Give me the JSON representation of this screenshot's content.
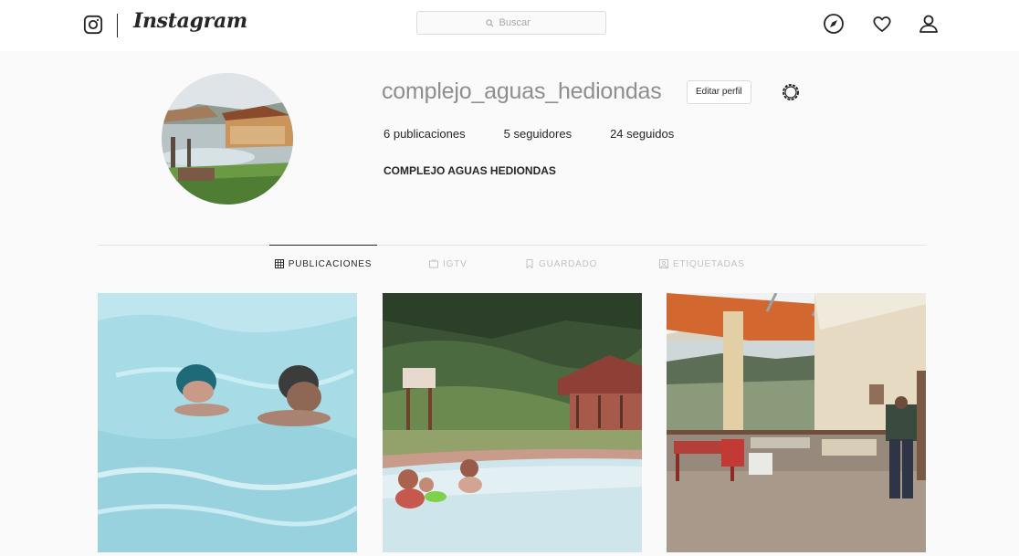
{
  "header": {
    "brand": "Instagram",
    "search_placeholder": "Buscar",
    "icons": [
      "instagram-glyph-icon",
      "compass-icon",
      "heart-icon",
      "person-icon",
      "search-icon"
    ]
  },
  "profile": {
    "username": "complejo_aguas_hediondas",
    "edit_label": "Editar perfil",
    "stats": [
      {
        "label": "6 publicaciones"
      },
      {
        "label": "5 seguidores"
      },
      {
        "label": "24 seguidos"
      }
    ],
    "full_name": "COMPLEJO AGUAS HEDIONDAS"
  },
  "tabs": [
    {
      "label": "PUBLICACIONES",
      "active": true,
      "icon": "grid-icon"
    },
    {
      "label": "IGTV",
      "active": false,
      "icon": "tv-icon"
    },
    {
      "label": "GUARDADO",
      "active": false,
      "icon": "bookmark-icon"
    },
    {
      "label": "ETIQUETADAS",
      "active": false,
      "icon": "tag-icon"
    }
  ],
  "posts": [
    {
      "subject": "swimmers-in-pool"
    },
    {
      "subject": "hot-spring-pool-with-hut"
    },
    {
      "subject": "covered-terrace-with-tables"
    }
  ],
  "colors": {
    "text": "#262626",
    "muted": "#8e8e8e",
    "border": "#dbdbdb",
    "background": "#fafafa",
    "pool_water": "#a7dce6",
    "terrace_orange": "#d2682f"
  }
}
